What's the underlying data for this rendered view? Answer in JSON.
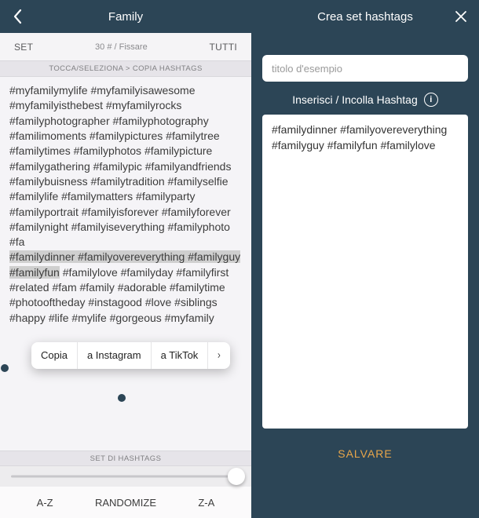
{
  "left": {
    "title": "Family",
    "tabs": {
      "set": "SET",
      "middle": "30 # / Fissare",
      "all": "TUTTI"
    },
    "subbar": "TOCCA/SELEZIONA > COPIA HASHTAGS",
    "hashtags_pre": "#myfamilymylife #myfamilyisawesome #myfamilyisthebest #myfamilyrocks #familyphotographer #familyphotography #familimoments #familypictures #familytree #familytimes #familyphotos #familypicture #familygathering #familypic #familyandfriends #familybuisness #familytradition #familyselfie #familylife #familymatters #familyparty #familyportrait #familyisforever #familyforever #familynight #familyiseverything #familyphoto #fa",
    "hashtags_selected": "#familydinner #familyovereverything #familyguy #familyfun",
    "hashtags_post": " #familylove #familyday #familyfirst #related #fam #family #adorable #familytime #photooftheday #instagood #love #siblings #happy #life #mylife #gorgeous #myfamily",
    "context_menu": {
      "copy": "Copia",
      "instagram": "a Instagram",
      "tiktok": "a TikTok"
    },
    "set_label": "SET DI HASHTAGS",
    "sort": {
      "az": "A-Z",
      "randomize": "RANDOMIZE",
      "za": "Z-A"
    }
  },
  "right": {
    "title": "Crea set hashtags",
    "title_input_placeholder": "titolo d'esempio",
    "insert_label": "Inserisci / Incolla Hashtag",
    "pasted_text": "#familydinner #familyovereverything #familyguy #familyfun #familylove",
    "save": "SALVARE"
  }
}
